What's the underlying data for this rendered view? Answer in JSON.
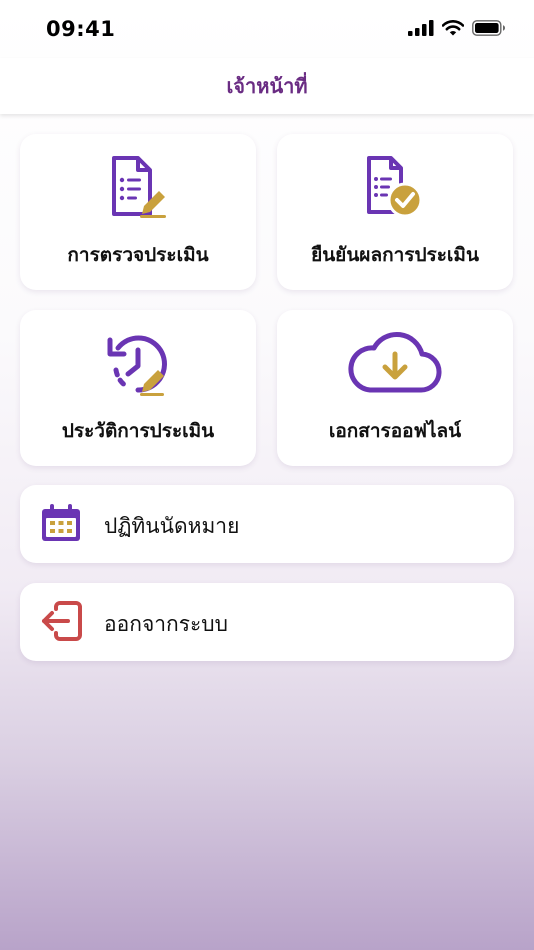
{
  "status_bar": {
    "time": "09:41",
    "icons": [
      "cellular-signal-icon",
      "wifi-icon",
      "battery-icon"
    ]
  },
  "header": {
    "title": "เจ้าหน้าที่"
  },
  "menu_tiles": [
    {
      "label": "การตรวจประเมิน",
      "icon": "clipboard-edit-icon"
    },
    {
      "label": "ยืนยันผลการประเมิน",
      "icon": "clipboard-check-icon"
    },
    {
      "label": "ประวัติการประเมิน",
      "icon": "history-edit-icon"
    },
    {
      "label": "เอกสารออฟไลน์",
      "icon": "cloud-download-icon"
    }
  ],
  "menu_rows": [
    {
      "label": "ปฏิทินนัดหมาย",
      "icon": "calendar-icon"
    },
    {
      "label": "ออกจากระบบ",
      "icon": "logout-icon"
    }
  ],
  "colors": {
    "primary_purple": "#6a35b3",
    "accent_gold": "#c9a13d",
    "logout_red": "#c94a4a",
    "title_purple": "#6a2c83"
  }
}
